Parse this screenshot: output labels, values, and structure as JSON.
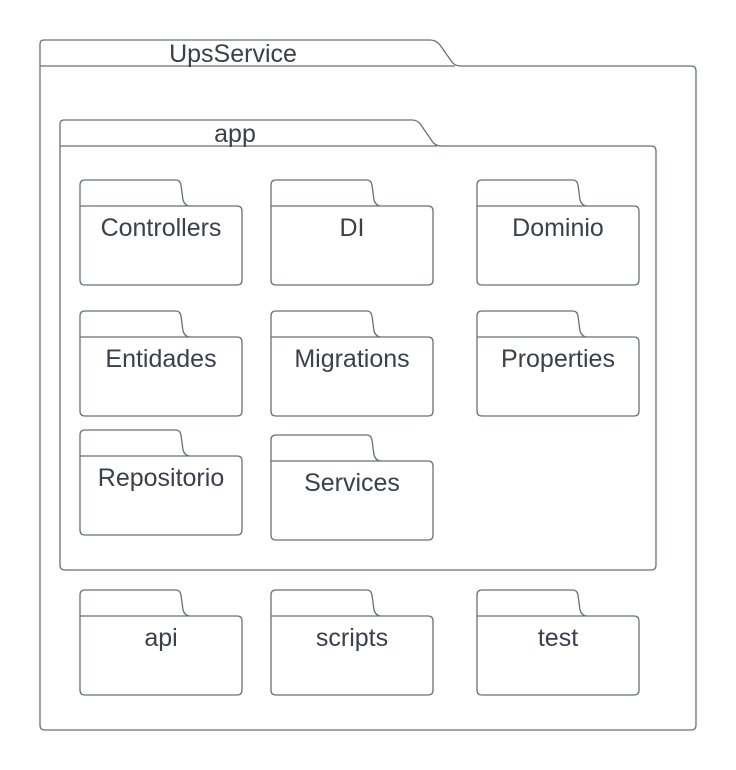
{
  "diagram": {
    "type": "package-diagram",
    "root": {
      "name": "UpsService",
      "children": [
        {
          "name": "app",
          "children": [
            {
              "name": "Controllers"
            },
            {
              "name": "DI"
            },
            {
              "name": "Dominio"
            },
            {
              "name": "Entidades"
            },
            {
              "name": "Migrations"
            },
            {
              "name": "Properties"
            },
            {
              "name": "Repositorio"
            },
            {
              "name": "Services"
            }
          ]
        },
        {
          "name": "api"
        },
        {
          "name": "scripts"
        },
        {
          "name": "test"
        }
      ]
    },
    "colors": {
      "stroke": "#6b7075",
      "text": "#3a414a",
      "fill": "#ffffff"
    }
  }
}
